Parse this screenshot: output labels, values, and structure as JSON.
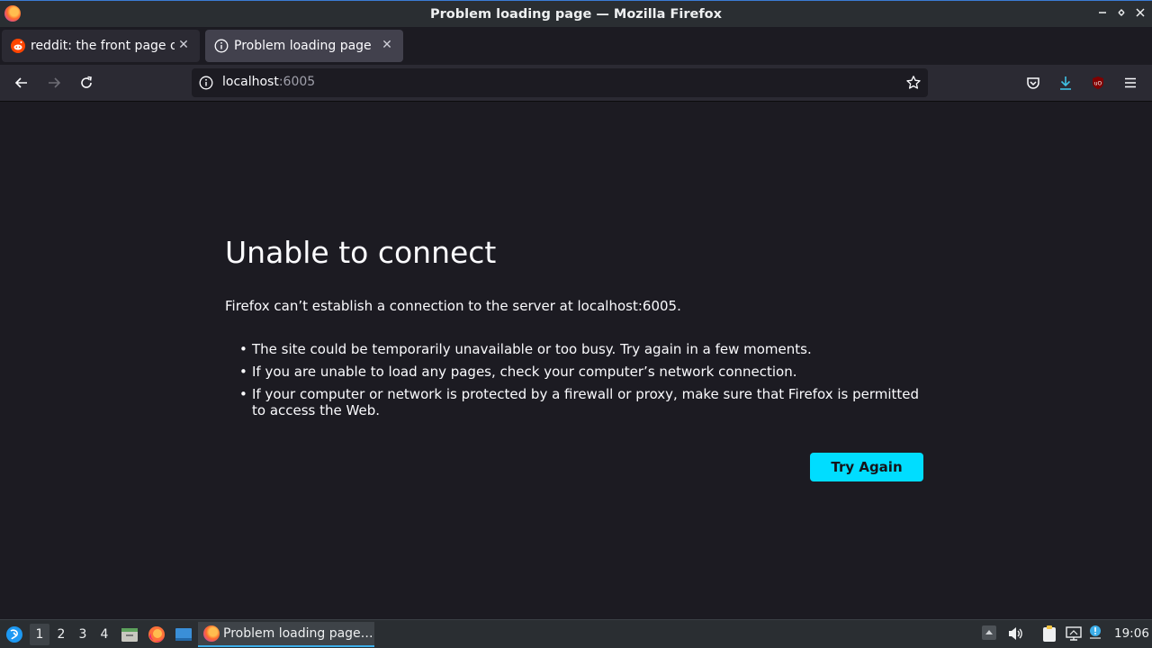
{
  "window": {
    "title": "Problem loading page — Mozilla Firefox"
  },
  "tabs": [
    {
      "label": "reddit: the front page of the internet",
      "favicon": "reddit-icon",
      "active": false
    },
    {
      "label": "Problem loading page",
      "favicon": "info-icon",
      "active": true
    }
  ],
  "urlbar": {
    "host": "localhost",
    "port": ":6005"
  },
  "error": {
    "title": "Unable to connect",
    "description": "Firefox can’t establish a connection to the server at localhost:6005.",
    "items": [
      "The site could be temporarily unavailable or too busy. Try again in a few moments.",
      "If you are unable to load any pages, check your computer’s network connection.",
      "If your computer or network is protected by a firewall or proxy, make sure that Firefox is permitted to access the Web."
    ],
    "button": "Try Again"
  },
  "taskbar": {
    "desktops": [
      "1",
      "2",
      "3",
      "4"
    ],
    "current_desktop": "1",
    "window_label": "Problem loading page…",
    "clock": "19:06"
  },
  "colors": {
    "accent": "#00ddff",
    "page_bg": "#1c1b22",
    "toolbar_bg": "#2b2a33",
    "download_icon": "#54ffbd"
  }
}
